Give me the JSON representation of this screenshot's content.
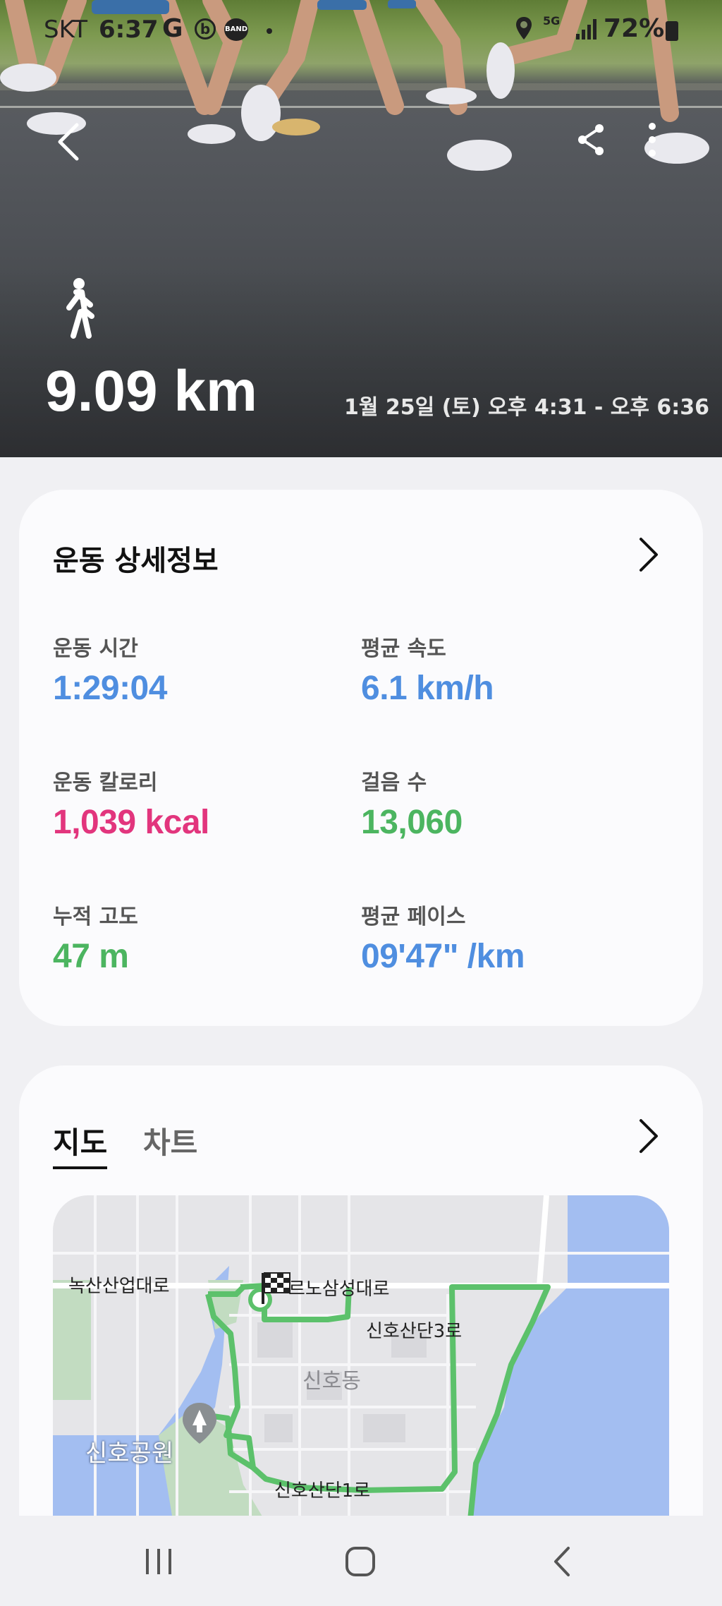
{
  "status_bar": {
    "carrier": "SKT",
    "time": "6:37",
    "g_icon": "G",
    "b_icon": "b",
    "band_icon": "BAND",
    "network": "5G",
    "battery": "72%"
  },
  "hero": {
    "distance": "9.09 km",
    "datetime": "1월 25일 (토) 오후 4:31 - 오후 6:36",
    "icons": [
      "back-icon",
      "share-icon",
      "more-icon",
      "walking-icon"
    ]
  },
  "details": {
    "title": "운동 상세정보",
    "stats": [
      {
        "label": "운동 시간",
        "value": "1:29:04",
        "color": "#4f8ee0"
      },
      {
        "label": "평균 속도",
        "value": "6.1 km/h",
        "color": "#4f8ee0"
      },
      {
        "label": "운동 칼로리",
        "value": "1,039 kcal",
        "color": "#e2357d"
      },
      {
        "label": "걸음 수",
        "value": "13,060",
        "color": "#4cb560"
      },
      {
        "label": "누적 고도",
        "value": "47 m",
        "color": "#4cb560"
      },
      {
        "label": "평균 페이스",
        "value": "09'47\" /km",
        "color": "#4f8ee0"
      }
    ]
  },
  "map_section": {
    "tabs": [
      {
        "label": "지도",
        "active": true
      },
      {
        "label": "차트",
        "active": false
      }
    ],
    "map_labels": {
      "road1": "녹산산업대로",
      "road2": "르노삼성대로",
      "road3": "신호산단3로",
      "district": "신호동",
      "park": "신호공원",
      "road4": "신호산단1로"
    },
    "route_color": "#5cc16b"
  },
  "navbar": {
    "buttons": [
      "recent-apps-icon",
      "home-icon",
      "back-icon"
    ]
  }
}
